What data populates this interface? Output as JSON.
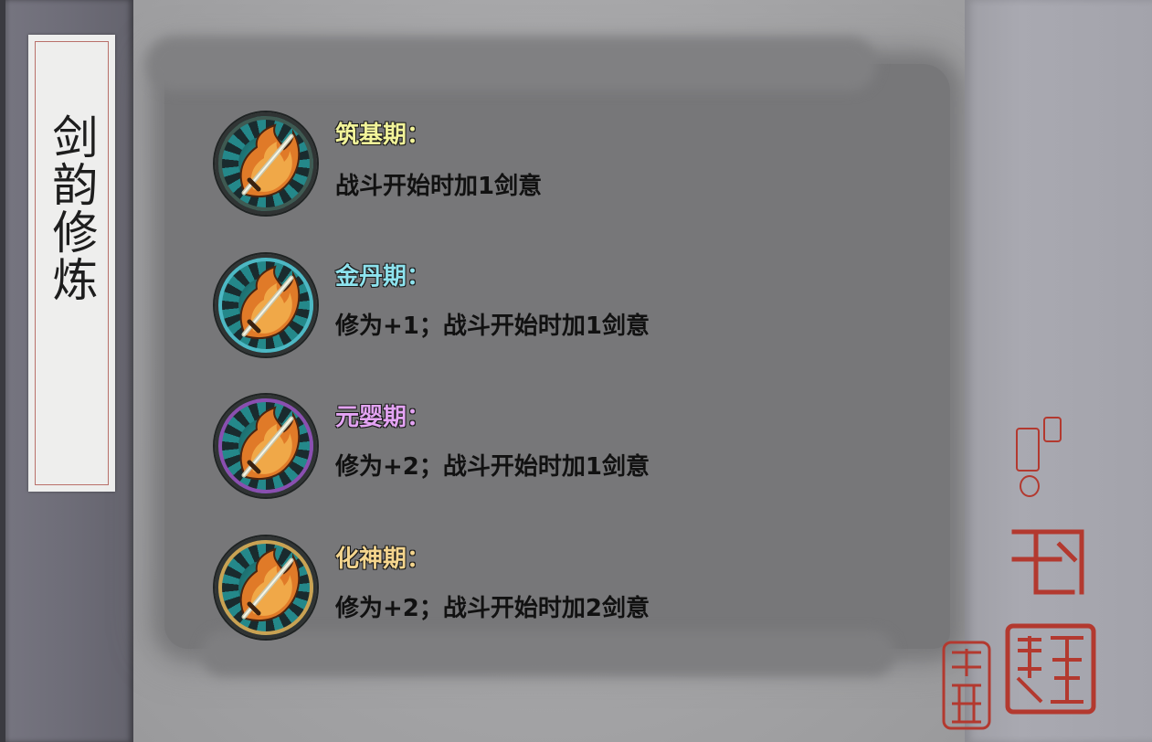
{
  "spine": {
    "title": "剑韵修炼"
  },
  "realms": [
    {
      "name": "筑基期：",
      "desc": "战斗开始时加1剑意",
      "name_color": "#f2f49a",
      "ring_color": "#3f5a52"
    },
    {
      "name": "金丹期：",
      "desc": "修为+1；战斗开始时加1剑意",
      "name_color": "#8ee3ee",
      "ring_color": "#4db8c4"
    },
    {
      "name": "元婴期：",
      "desc": "修为+2；战斗开始时加1剑意",
      "name_color": "#e4a4f4",
      "ring_color": "#8a4fb0"
    },
    {
      "name": "化神期：",
      "desc": "修为+2；战斗开始时加2剑意",
      "name_color": "#f4d58e",
      "ring_color": "#c9a253"
    }
  ],
  "icons": {
    "realm_icon": "flaming-sword-icon",
    "seals": [
      "red-seal-stamp-icon"
    ]
  },
  "colors": {
    "seal_red": "#b3392f",
    "spine": "#6e6d78",
    "paper": "#a9a9ab",
    "ink_wash": "#777779"
  }
}
